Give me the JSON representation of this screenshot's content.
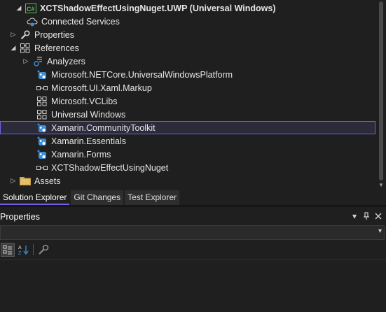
{
  "solution_explorer": {
    "items": [
      {
        "label": "XCTShadowEffectUsingNuget.UWP (Universal Windows)",
        "icon": "csharp-project-icon",
        "arrow": "expanded",
        "bold": true
      },
      {
        "label": "Connected Services",
        "icon": "connected-services-icon",
        "arrow": "none"
      },
      {
        "label": "Properties",
        "icon": "wrench-icon",
        "arrow": "collapsed"
      },
      {
        "label": "References",
        "icon": "references-icon",
        "arrow": "expanded"
      },
      {
        "label": "Analyzers",
        "icon": "analyzer-icon",
        "arrow": "collapsed"
      },
      {
        "label": "Microsoft.NETCore.UniversalWindowsPlatform",
        "icon": "nuget-package-icon",
        "arrow": "none"
      },
      {
        "label": "Microsoft.UI.Xaml.Markup",
        "icon": "project-reference-icon",
        "arrow": "none"
      },
      {
        "label": "Microsoft.VCLibs",
        "icon": "references-icon",
        "arrow": "none"
      },
      {
        "label": "Universal Windows",
        "icon": "references-icon",
        "arrow": "none"
      },
      {
        "label": "Xamarin.CommunityToolkit",
        "icon": "nuget-package-icon",
        "arrow": "none",
        "selected": true
      },
      {
        "label": "Xamarin.Essentials",
        "icon": "nuget-package-icon",
        "arrow": "none"
      },
      {
        "label": "Xamarin.Forms",
        "icon": "nuget-package-icon",
        "arrow": "none"
      },
      {
        "label": "XCTShadowEffectUsingNuget",
        "icon": "project-reference-icon",
        "arrow": "none"
      },
      {
        "label": "Assets",
        "icon": "folder-icon",
        "arrow": "collapsed"
      }
    ]
  },
  "tabs": [
    {
      "label": "Solution Explorer",
      "active": true
    },
    {
      "label": "Git Changes",
      "active": false
    },
    {
      "label": "Test Explorer",
      "active": false
    }
  ],
  "properties": {
    "title": "Properties",
    "header_icons": [
      "window-position-dropdown-icon",
      "pin-icon",
      "close-icon"
    ],
    "toolbar_icons": [
      "categorized-icon",
      "alphabetical-sort-icon",
      "property-pages-icon"
    ]
  },
  "colors": {
    "background": "#1f1f1f",
    "accent": "#7160e8",
    "selected_row": "#2b2b3a",
    "nuget_blue": "#3b8fd9"
  }
}
